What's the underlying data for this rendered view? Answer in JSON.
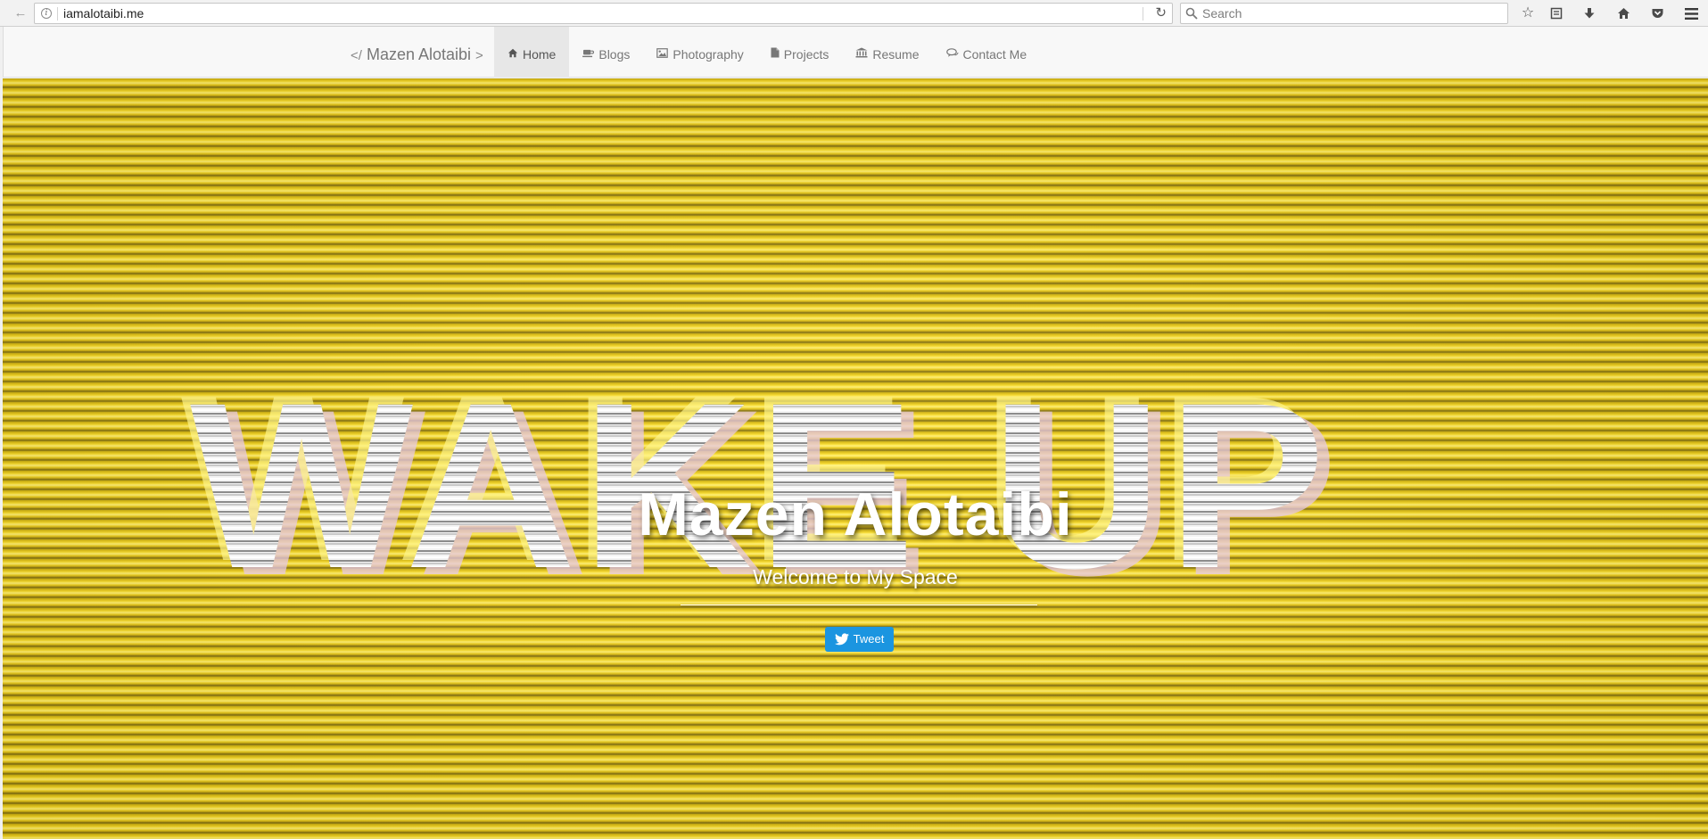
{
  "browser": {
    "url": "iamalotaibi.me",
    "search_placeholder": "Search"
  },
  "navbar": {
    "brand": "Mazen Alotaibi",
    "brand_prefix": "</",
    "brand_suffix": ">",
    "items": [
      {
        "label": "Home",
        "icon": "home-icon",
        "active": true
      },
      {
        "label": "Blogs",
        "icon": "coffee-icon",
        "active": false
      },
      {
        "label": "Photography",
        "icon": "photo-icon",
        "active": false
      },
      {
        "label": "Projects",
        "icon": "file-icon",
        "active": false
      },
      {
        "label": "Resume",
        "icon": "institution-icon",
        "active": false
      },
      {
        "label": "Contact Me",
        "icon": "chat-icon",
        "active": false
      }
    ]
  },
  "hero": {
    "background_text": "WAKE UP",
    "title": "Mazen Alotaibi",
    "subtitle": "Welcome to My Space",
    "tweet_label": "Tweet",
    "accent_color": "#f2d51f",
    "tweet_color": "#1b95e0"
  }
}
